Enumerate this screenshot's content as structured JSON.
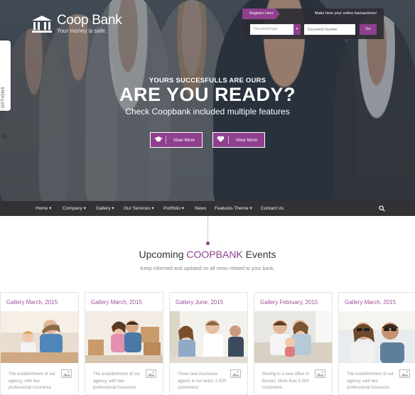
{
  "brand": {
    "title": "Coop Bank",
    "tagline": "Your money is safe."
  },
  "theme_options": {
    "label": "THEME OPTIONS"
  },
  "register": {
    "tab_label": "Register Here",
    "prompt": "Make here your online transactions!",
    "select_value": "Document type",
    "input_placeholder": "Document Number",
    "go_label": "Go"
  },
  "hero": {
    "kicker": "YOURS SUCCESFULLS ARE OURS",
    "title": "ARE YOU READY?",
    "subtitle": "Check Coopbank included multiple features",
    "buttons": [
      {
        "label": "View More",
        "icon": "graduation-cap-icon"
      },
      {
        "label": "View More",
        "icon": "heart-icon"
      }
    ]
  },
  "nav": {
    "items": [
      {
        "label": "Home",
        "dropdown": "▾"
      },
      {
        "label": "Company",
        "dropdown": "▾"
      },
      {
        "label": "Gallery",
        "dropdown": "▾"
      },
      {
        "label": "Our Services",
        "dropdown": "▾"
      },
      {
        "label": "Portfolio",
        "dropdown": "▾"
      },
      {
        "label": "News",
        "dropdown": ""
      },
      {
        "label": "Features Theme",
        "dropdown": "▾"
      },
      {
        "label": "Contact Us",
        "dropdown": ""
      }
    ],
    "search_icon": "search-icon"
  },
  "events": {
    "title_pre": "Upcoming ",
    "title_accent": "COOPBANK",
    "title_post": " Events",
    "subtitle": "Keep informed and updated on all news related to your bank.",
    "cards": [
      {
        "date": "Gallery March, 2015",
        "text": "The establishment of our agency, with two professional insurance",
        "photo": "mother-and-child-photo"
      },
      {
        "date": "Gallery March, 2015",
        "text": "The establishment of our agency, with two professional insurance",
        "photo": "couple-moving-boxes-photo"
      },
      {
        "date": "Gallery June, 2015",
        "text": "Three new insurance agents in our team. 2.500 customers!",
        "photo": "agents-meeting-photo"
      },
      {
        "date": "Gallery February, 2015",
        "text": "Moving to a new office in Boston. More than 5.000 customers.",
        "photo": "family-couch-photo"
      },
      {
        "date": "Gallery March, 2015",
        "text": "The establishment of our agency, with two professional insurance",
        "photo": "couple-sunglasses-photo"
      }
    ]
  },
  "colors": {
    "accent": "#8e3f8e",
    "nav_bg": "#323235",
    "card_date": "#9b4f9b"
  }
}
